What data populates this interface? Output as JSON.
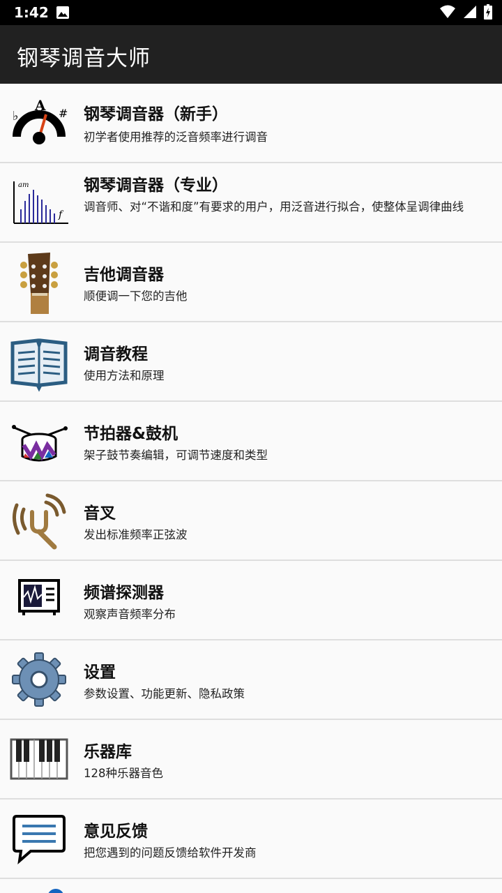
{
  "status_bar": {
    "time": "1:42"
  },
  "app": {
    "title": "钢琴调音大师"
  },
  "menu": [
    {
      "title": "钢琴调音器（新手）",
      "desc": "初学者使用推荐的泛音频率进行调音",
      "icon": "tuner-gauge-icon"
    },
    {
      "title": "钢琴调音器（专业）",
      "desc": "调音师、对“不谐和度”有要求的用户，用泛音进行拟合，使整体呈调律曲线",
      "icon": "spectrum-bars-icon"
    },
    {
      "title": "吉他调音器",
      "desc": "顺便调一下您的吉他",
      "icon": "guitar-head-icon"
    },
    {
      "title": "调音教程",
      "desc": "使用方法和原理",
      "icon": "book-icon"
    },
    {
      "title": "节拍器&鼓机",
      "desc": "架子鼓节奏编辑，可调节速度和类型",
      "icon": "drum-icon"
    },
    {
      "title": "音叉",
      "desc": "发出标准频率正弦波",
      "icon": "tuning-fork-icon"
    },
    {
      "title": "频谱探测器",
      "desc": "观察声音频率分布",
      "icon": "spectrum-monitor-icon"
    },
    {
      "title": "设置",
      "desc": "参数设置、功能更新、隐私政策",
      "icon": "gear-icon"
    },
    {
      "title": "乐器库",
      "desc": "128种乐器音色",
      "icon": "piano-keys-icon"
    },
    {
      "title": "意见反馈",
      "desc": "把您遇到的问题反馈给软件开发商",
      "icon": "feedback-icon"
    }
  ]
}
